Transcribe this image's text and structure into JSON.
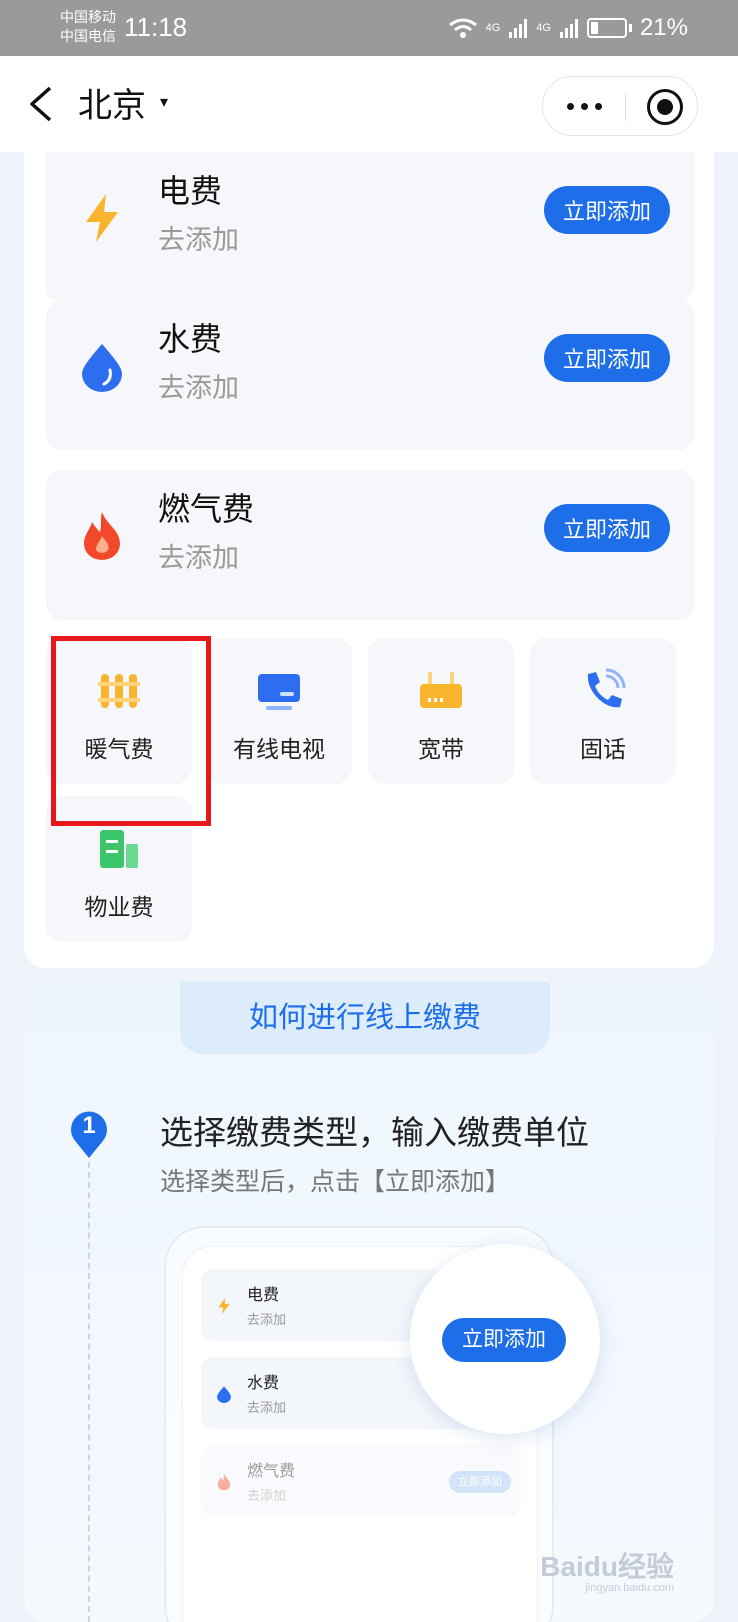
{
  "status_bar": {
    "carrier_1": "中国移动",
    "carrier_2": "中国电信",
    "time": "11:18",
    "signal_1": "4G",
    "signal_2": "4G",
    "battery": "21%"
  },
  "nav": {
    "city": "北京",
    "city_caret": "▾"
  },
  "bills": [
    {
      "title": "电费",
      "subtitle": "去添加",
      "button": "立即添加",
      "icon": "lightning-icon",
      "color": "#f8b42c"
    },
    {
      "title": "水费",
      "subtitle": "去添加",
      "button": "立即添加",
      "icon": "water-drop-icon",
      "color": "#2d6ef0"
    },
    {
      "title": "燃气费",
      "subtitle": "去添加",
      "button": "立即添加",
      "icon": "flame-icon",
      "color": "#f2492d"
    }
  ],
  "more_types": [
    {
      "label": "暖气费",
      "icon": "radiator-icon",
      "color": "#f8b42c"
    },
    {
      "label": "有线电视",
      "icon": "tv-icon",
      "color": "#2d6ef0"
    },
    {
      "label": "宽带",
      "icon": "router-icon",
      "color": "#f8b42c"
    },
    {
      "label": "固话",
      "icon": "phone-icon",
      "color": "#2d6ef0"
    },
    {
      "label": "物业费",
      "icon": "building-icon",
      "color": "#3cc56a"
    }
  ],
  "tutorial": {
    "header": "如何进行线上缴费",
    "step_number": "1",
    "step_title": "选择缴费类型，输入缴费单位",
    "step_subtitle": "选择类型后，点击【立即添加】",
    "mock_rows": [
      {
        "title": "电费",
        "subtitle": "去添加"
      },
      {
        "title": "水费",
        "subtitle": "去添加"
      },
      {
        "title": "燃气费",
        "subtitle": "去添加",
        "button": "立即添加"
      }
    ],
    "zoom_button": "立即添加"
  },
  "watermark": {
    "brand": "Baidu经验",
    "url": "jingyan.baidu.com"
  },
  "colors": {
    "accent": "#1d6ee8",
    "highlight": "#e8171a"
  }
}
